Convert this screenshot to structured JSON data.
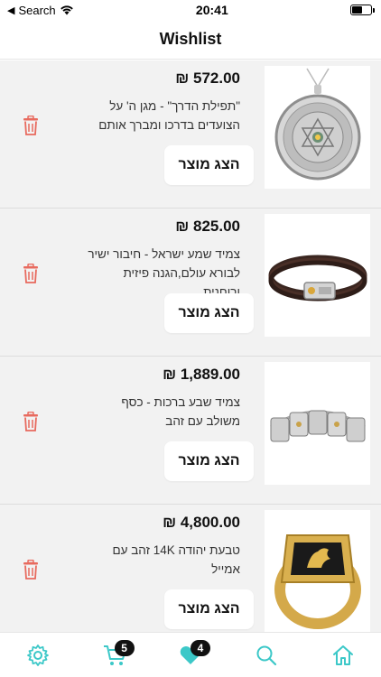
{
  "status_bar": {
    "carrier": "Search",
    "time": "20:41"
  },
  "header": {
    "title": "Wishlist"
  },
  "theme": {
    "accent": "#3cc8c8",
    "delete": "#e86a5e"
  },
  "items": [
    {
      "price": "₪ 572.00",
      "title": "\"תפילת הדרך\" - מגן ה' על הצועדים בדרכו ומברך אותם",
      "button": "הצג מוצר",
      "image": "silver-pendant"
    },
    {
      "price": "₪ 825.00",
      "title": "צמיד שמע ישראל - חיבור ישיר לבורא עולם,הגנה פיזית ורוחנית",
      "button": "הצג מוצר",
      "image": "leather-bracelet"
    },
    {
      "price": "₪ 1,889.00",
      "title": "צמיד שבע ברכות - כסף משולב עם זהב",
      "button": "הצג מוצר",
      "image": "silver-bracelet"
    },
    {
      "price": "₪ 4,800.00",
      "title": "טבעת יהודה 14K זהב עם אמייל",
      "button": "הצג מוצר",
      "image": "gold-ring"
    }
  ],
  "tabbar": {
    "cart_badge": "5",
    "wishlist_badge": "4"
  }
}
